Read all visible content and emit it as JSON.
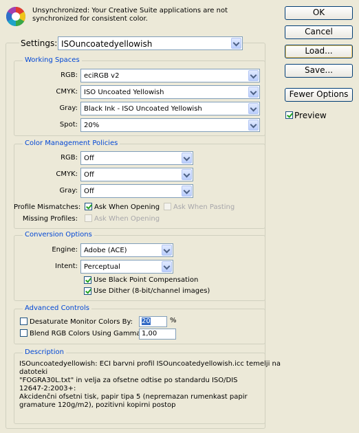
{
  "header": {
    "icon": "color-wheel-icon",
    "message_line1": "Unsynchronized: Your Creative Suite applications are not",
    "message_line2": "synchronized for consistent color."
  },
  "buttons": {
    "ok": "OK",
    "cancel": "Cancel",
    "load": "Load...",
    "save": "Save...",
    "fewer_options": "Fewer Options"
  },
  "preview": {
    "label": "Preview",
    "checked": true
  },
  "settings": {
    "label": "Settings:",
    "value": "ISOuncoatedyellowish"
  },
  "working_spaces": {
    "title": "Working Spaces",
    "rgb_label": "RGB:",
    "rgb_value": "eciRGB v2",
    "cmyk_label": "CMYK:",
    "cmyk_value": "ISO Uncoated Yellowish",
    "gray_label": "Gray:",
    "gray_value": "Black Ink - ISO Uncoated Yellowish",
    "spot_label": "Spot:",
    "spot_value": "20%"
  },
  "policies": {
    "title": "Color Management Policies",
    "rgb_label": "RGB:",
    "rgb_value": "Off",
    "cmyk_label": "CMYK:",
    "cmyk_value": "Off",
    "gray_label": "Gray:",
    "gray_value": "Off",
    "mismatch_label": "Profile Mismatches:",
    "ask_opening": "Ask When Opening",
    "ask_pasting": "Ask When Pasting",
    "missing_label": "Missing Profiles:",
    "missing_ask_opening": "Ask When Opening"
  },
  "conversion": {
    "title": "Conversion Options",
    "engine_label": "Engine:",
    "engine_value": "Adobe (ACE)",
    "intent_label": "Intent:",
    "intent_value": "Perceptual",
    "black_point": "Use Black Point Compensation",
    "dither": "Use Dither (8-bit/channel images)"
  },
  "advanced": {
    "title": "Advanced Controls",
    "desaturate_label": "Desaturate Monitor Colors By:",
    "desaturate_value": "20",
    "desaturate_unit": "%",
    "blend_label": "Blend RGB Colors Using Gamma:",
    "blend_value": "1,00"
  },
  "description": {
    "title": "Description",
    "lines": [
      "ISOuncoatedyellowish:   ECI barvni profil ISOuncoatedyellowish.icc temelji na",
      "datoteki",
      "\"FOGRA30L.txt\" in velja za ofsetne odtise po standardu ISO/DIS",
      "12647-2:2003+:",
      "Akcidenčni ofsetni tisk, papir tipa 5 (nepremazan rumenkast papir",
      "gramature 120g/m2), pozitivni kopirni postop"
    ]
  }
}
